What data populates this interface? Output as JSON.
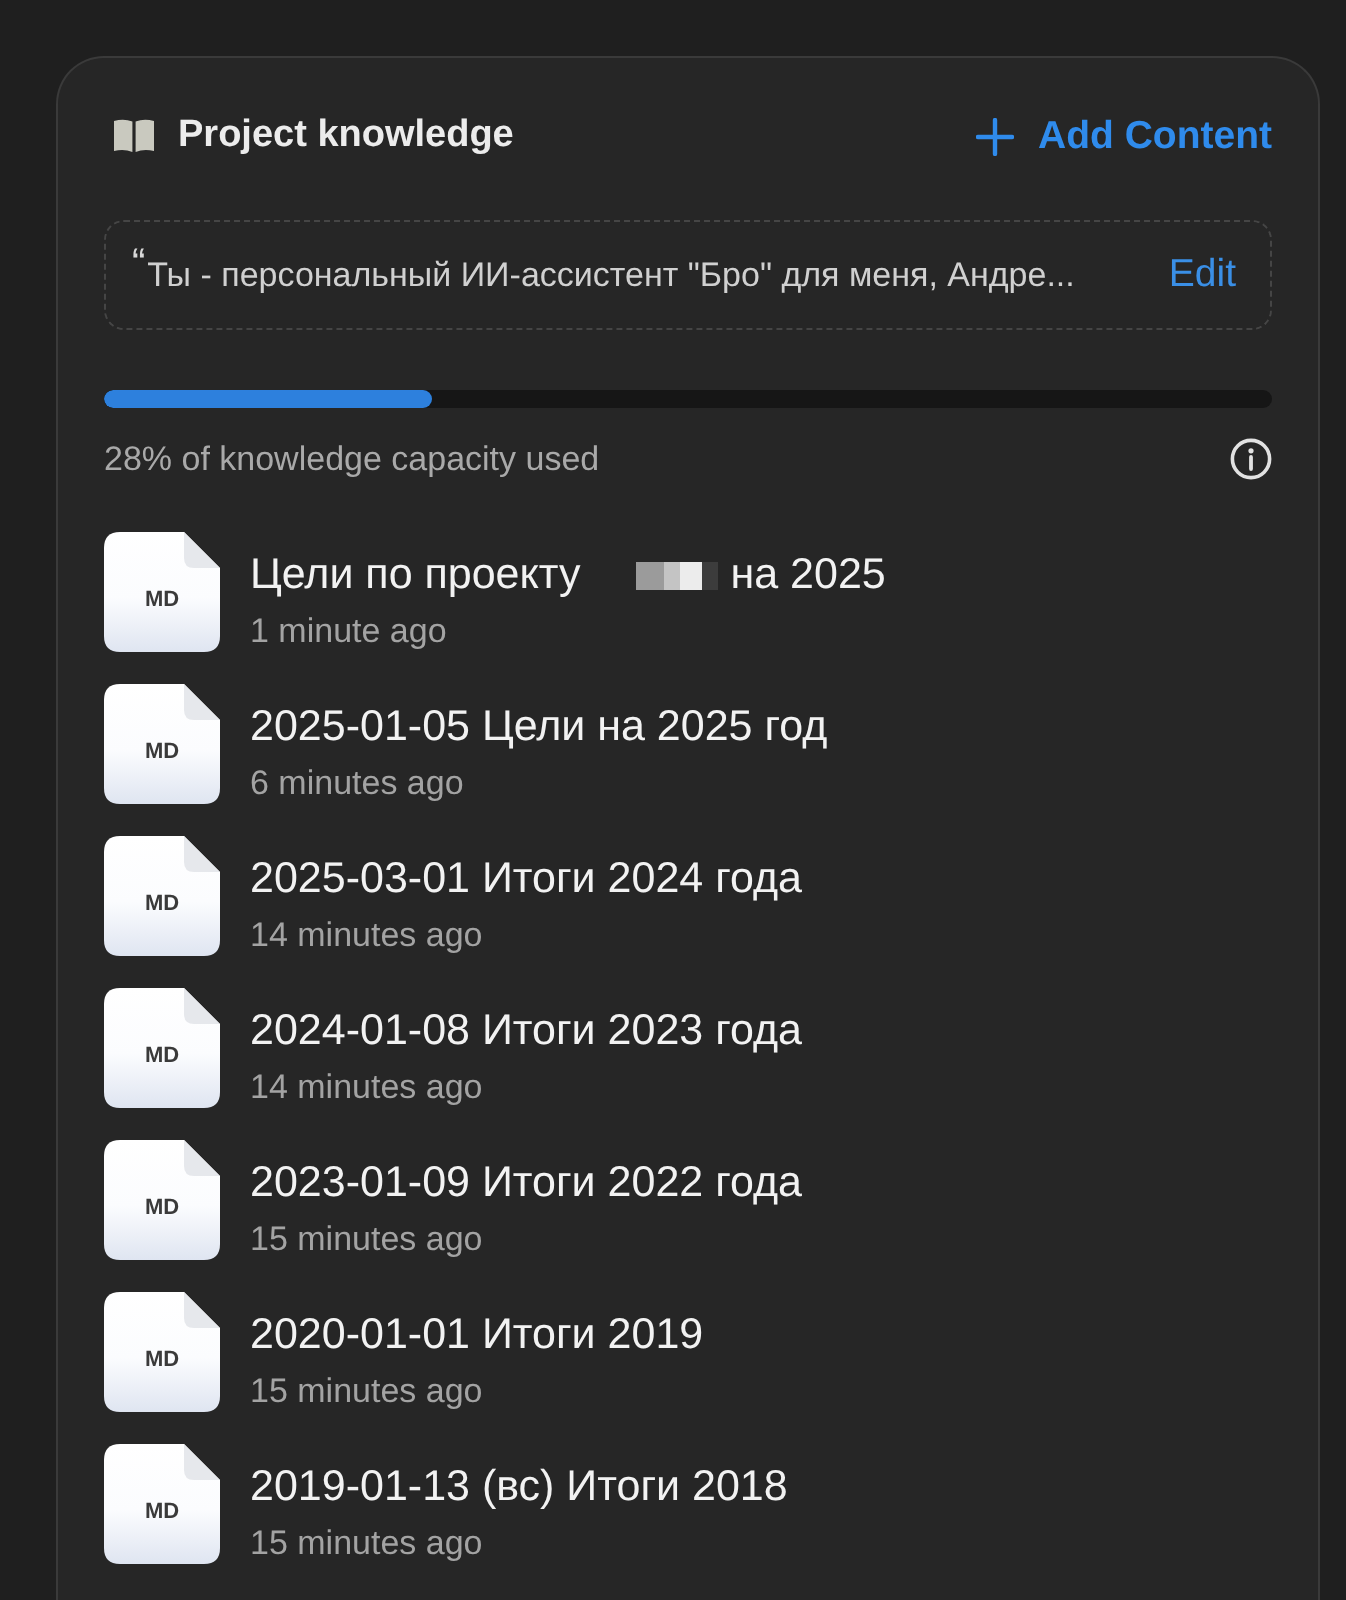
{
  "header": {
    "title": "Project knowledge",
    "add_button": {
      "label": "Add Content"
    }
  },
  "instructions": {
    "quote_mark": "“",
    "text": "Ты - персональный ИИ-ассистент \"Бро\" для меня, Андре...",
    "edit_label": "Edit"
  },
  "capacity": {
    "level": 0.28,
    "caption": "28% of knowledge capacity used"
  },
  "files": [
    {
      "type_label": "MD",
      "title": "Цели по проекту",
      "redacted": true,
      "title_suffix": "на 2025",
      "time": "1 minute ago"
    },
    {
      "type_label": "MD",
      "title": "2025-01-05 Цели на 2025 год",
      "redacted": false,
      "time": "6 minutes ago"
    },
    {
      "type_label": "MD",
      "title": "2025-03-01 Итоги 2024 года",
      "redacted": false,
      "time": "14 minutes ago"
    },
    {
      "type_label": "MD",
      "title": "2024-01-08 Итоги 2023 года",
      "redacted": false,
      "time": "14 minutes ago"
    },
    {
      "type_label": "MD",
      "title": "2023-01-09 Итоги 2022 года",
      "redacted": false,
      "time": "15 minutes ago"
    },
    {
      "type_label": "MD",
      "title": "2020-01-01 Итоги 2019",
      "redacted": false,
      "time": "15 minutes ago"
    },
    {
      "type_label": "MD",
      "title": "2019-01-13 (вс) Итоги 2018",
      "redacted": false,
      "time": "15 minutes ago"
    }
  ]
}
